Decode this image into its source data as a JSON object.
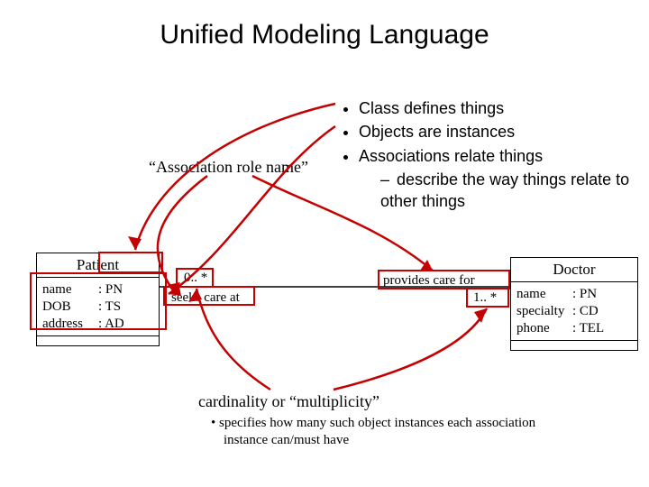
{
  "title": "Unified Modeling Language",
  "bullets": {
    "b1": "Class defines things",
    "b2": "Objects are instances",
    "b3": "Associations relate things",
    "b3a": "describe the way things relate to other things"
  },
  "association_role_label": "“Association role name”",
  "classes": {
    "patient": {
      "name": "Patient",
      "attrs": [
        {
          "name": "name",
          "type": ": PN"
        },
        {
          "name": "DOB",
          "type": ": TS"
        },
        {
          "name": "address",
          "type": ": AD"
        }
      ]
    },
    "doctor": {
      "name": "Doctor",
      "attrs": [
        {
          "name": "name",
          "type": ": PN"
        },
        {
          "name": "specialty",
          "type": ": CD"
        },
        {
          "name": "phone",
          "type": ": TEL"
        }
      ]
    }
  },
  "association": {
    "left_card": "0.. *",
    "left_role": "seeks care at",
    "right_role": "provides care for",
    "right_card": "1.. *"
  },
  "footer": {
    "heading": "cardinality or “multiplicity”",
    "detail": "specifies how many such object instances each association instance can/must have"
  },
  "colors": {
    "callout": "#c40000"
  }
}
